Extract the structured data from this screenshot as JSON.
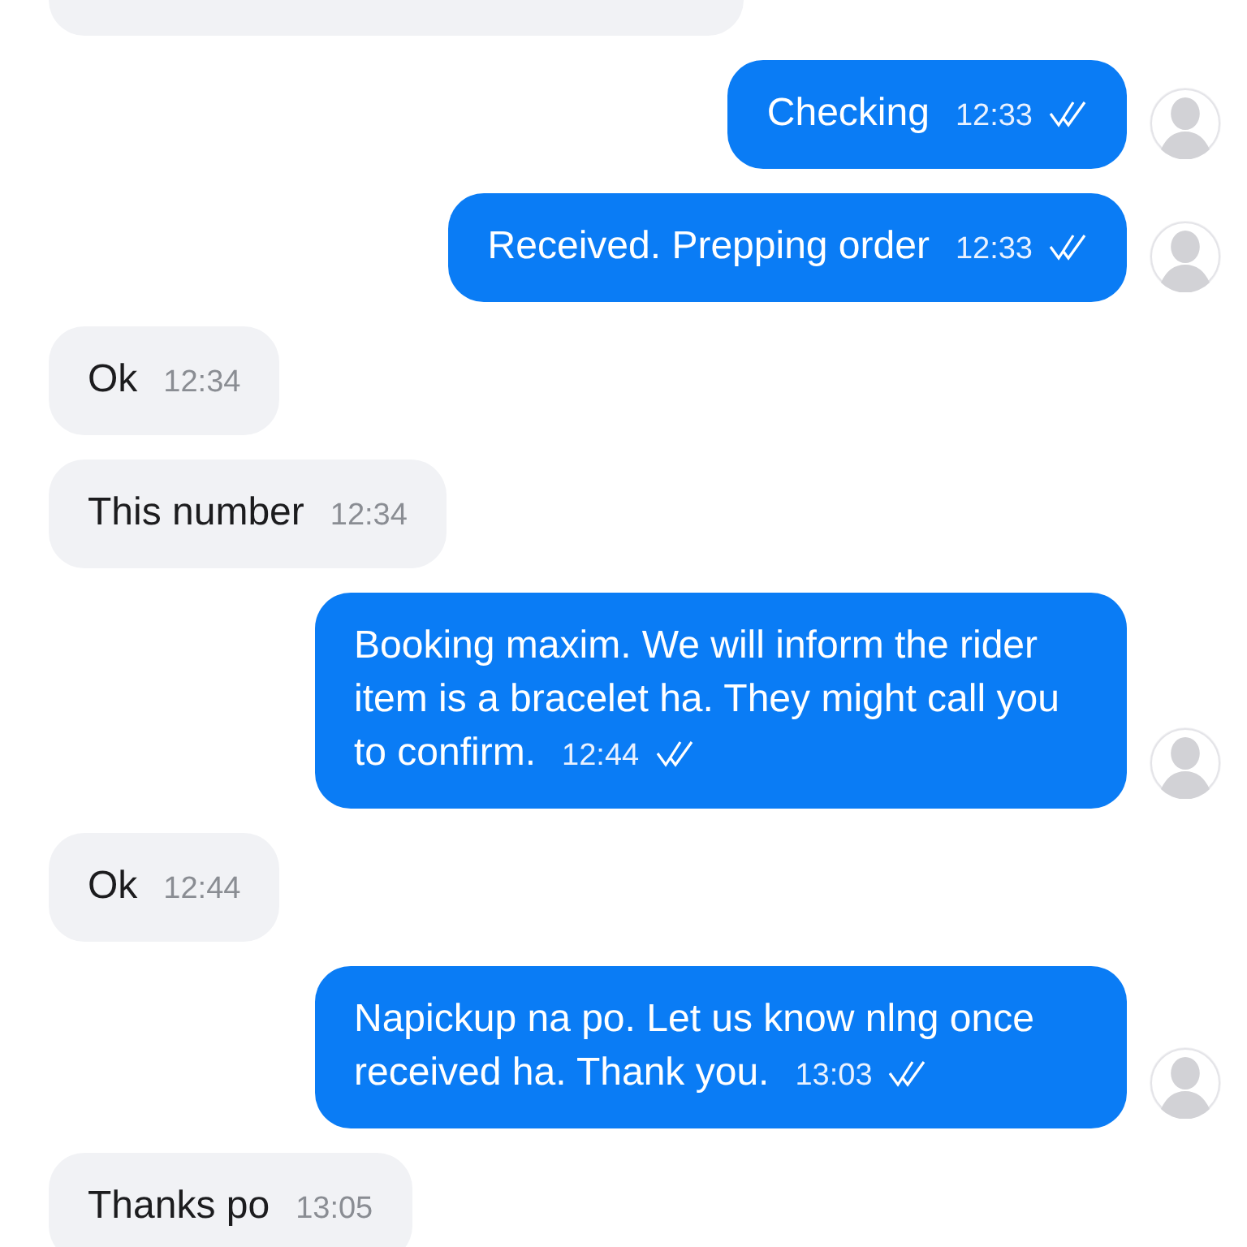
{
  "messages": [
    {
      "kind": "in"
    },
    {
      "kind": "out",
      "text": "Checking",
      "time": "12:33"
    },
    {
      "kind": "out",
      "text": "Received. Prepping order",
      "time": "12:33"
    },
    {
      "kind": "in",
      "text": "Ok",
      "time": "12:34"
    },
    {
      "kind": "in",
      "text": "This number",
      "time": "12:34"
    },
    {
      "kind": "out",
      "text": "Booking maxim. We will inform the rider item is a bracelet ha. They might call you to confirm.",
      "time": "12:44"
    },
    {
      "kind": "in",
      "text": "Ok",
      "time": "12:44"
    },
    {
      "kind": "out",
      "text": "Napickup na po. Let us know nlng once received ha. Thank you.",
      "time": "13:03"
    },
    {
      "kind": "in",
      "text": "Thanks po",
      "time": "13:05"
    }
  ]
}
